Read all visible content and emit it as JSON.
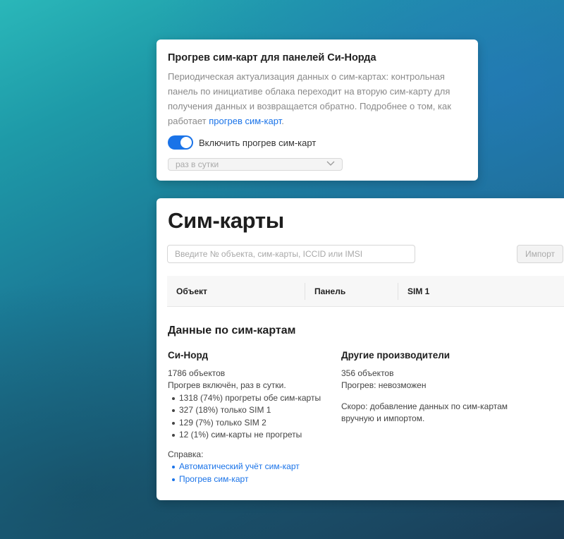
{
  "sim_warmup": {
    "title": "Прогрев сим-карт для панелей Си-Норда",
    "description": "Периодическая актуализация данных о сим-картах: контрольная панель по инициативе облака переходит на вторую сим-карту для получения данных и возвращается обратно. Подробнее о том, как работает ",
    "link_text": "прогрев сим-карт",
    "description_end": ".",
    "toggle_label": "Включить прогрев сим-карт",
    "toggle_on": true,
    "frequency_value": "раз в сутки"
  },
  "sim_page": {
    "title": "Сим-карты",
    "search_placeholder": "Введите № объекта, сим-карты, ICCID или IMSI",
    "import_label": "Импорт",
    "table_columns": [
      "Объект",
      "Панель",
      "SIM 1"
    ]
  },
  "stats": {
    "title": "Данные по сим-картам",
    "sinord": {
      "title": "Си-Норд",
      "objects": "1786 объектов",
      "status": "Прогрев включён, раз в сутки.",
      "items": [
        "1318 (74%) прогреты обе сим-карты",
        "327 (18%) только SIM 1",
        "129 (7%) только SIM 2",
        "12 (1%) сим-карты не прогреты"
      ],
      "help_label": "Справка:",
      "help_links": [
        "Автоматический учёт сим-карт",
        "Прогрев сим-карт"
      ]
    },
    "other": {
      "title": "Другие производители",
      "objects": "356 объектов",
      "status": "Прогрев: невозможен",
      "note": "Скоро: добавление данных по сим-картам вручную и импортом."
    }
  },
  "colors": {
    "accent": "#1a73e8"
  }
}
